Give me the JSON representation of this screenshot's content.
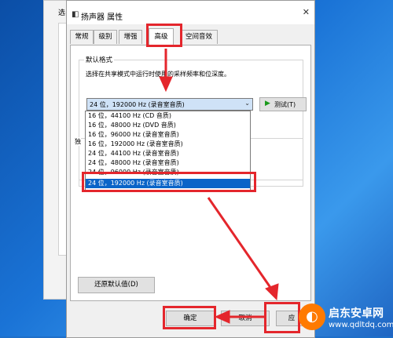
{
  "back_window": {
    "title": "选"
  },
  "dialog": {
    "title": "扬声器 属性",
    "tabs": [
      {
        "label": "常规"
      },
      {
        "label": "级别"
      },
      {
        "label": "增强"
      },
      {
        "label": "高级"
      },
      {
        "label": "空间音效"
      }
    ],
    "active_tab": "高级",
    "default_format": {
      "group_label": "默认格式",
      "description": "选择在共享模式中运行时使用的采样频率和位深度。",
      "selected": "24 位，192000 Hz (录音室音质)",
      "test_button": "测试(T)",
      "options": [
        "16 位，44100 Hz (CD 音质)",
        "16 位，48000 Hz (DVD 音质)",
        "16 位，96000 Hz (录音室音质)",
        "16 位，192000 Hz (录音室音质)",
        "24 位，44100 Hz (录音室音质)",
        "24 位，48000 Hz (录音室音质)",
        "24 位，96000 Hz (录音室音质)",
        "24 位，192000 Hz (录音室音质)"
      ]
    },
    "second_group_label": "独",
    "restore_button": "还原默认值(D)",
    "ok_button": "确定",
    "cancel_button": "取消",
    "apply_button": "应"
  },
  "watermark": {
    "title": "启东安卓网",
    "url": "www.qdltdq.com"
  },
  "colors": {
    "annotation": "#e4262c",
    "selection": "#0a64c8"
  },
  "icons": {
    "dialog": "speaker-icon",
    "test": "play-icon",
    "dropdown": "chevron-down-icon",
    "close": "close-icon"
  }
}
